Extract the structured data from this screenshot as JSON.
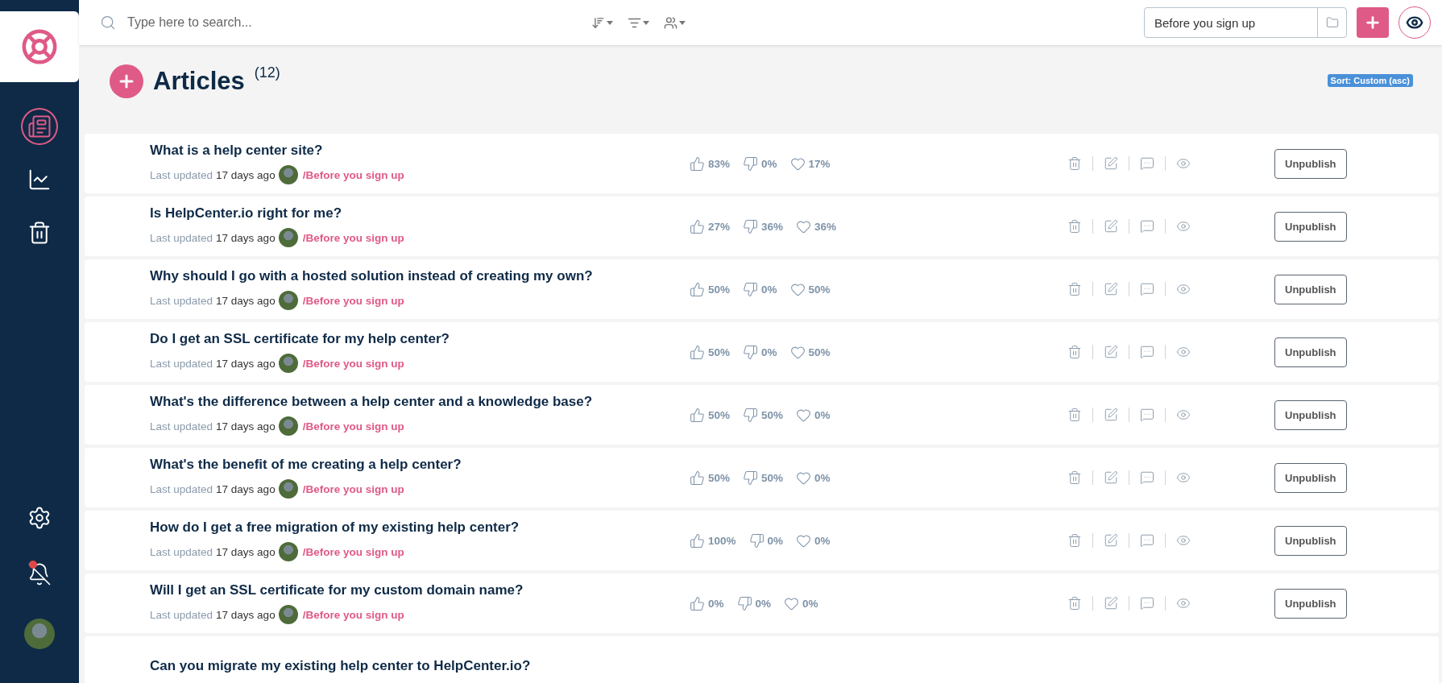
{
  "sidebar": {
    "items": [
      {
        "kind": "articles",
        "selected": true,
        "alert": false
      },
      {
        "kind": "analytics",
        "selected": false,
        "alert": false
      },
      {
        "kind": "trash",
        "selected": false,
        "alert": false
      },
      {
        "kind": "settings",
        "selected": false,
        "alert": false
      },
      {
        "kind": "notifications",
        "selected": false,
        "alert": true
      },
      {
        "kind": "profile",
        "selected": false,
        "alert": false
      }
    ]
  },
  "search": {
    "placeholder": "Type here to search..."
  },
  "toolbar": {
    "category_field": {
      "value": "Before you sign up"
    }
  },
  "header": {
    "title": "Articles",
    "count": "(12)",
    "sort_badge": "Sort: Custom (asc)"
  },
  "articles": [
    {
      "title": "What is a help center site?",
      "updated_label": "Last updated",
      "updated": "17 days ago",
      "category": "/Before you sign up",
      "likes": "83%",
      "dislikes": "0%",
      "loves": "17%",
      "action": "Unpublish"
    },
    {
      "title": "Is HelpCenter.io right for me?",
      "updated_label": "Last updated",
      "updated": "17 days ago",
      "category": "/Before you sign up",
      "likes": "27%",
      "dislikes": "36%",
      "loves": "36%",
      "action": "Unpublish"
    },
    {
      "title": "Why should I go with a hosted solution instead of creating my own?",
      "updated_label": "Last updated",
      "updated": "17 days ago",
      "category": "/Before you sign up",
      "likes": "50%",
      "dislikes": "0%",
      "loves": "50%",
      "action": "Unpublish"
    },
    {
      "title": "Do I get an SSL certificate for my help center?",
      "updated_label": "Last updated",
      "updated": "17 days ago",
      "category": "/Before you sign up",
      "likes": "50%",
      "dislikes": "0%",
      "loves": "50%",
      "action": "Unpublish"
    },
    {
      "title": "What's the difference between a help center and a knowledge base?",
      "updated_label": "Last updated",
      "updated": "17 days ago",
      "category": "/Before you sign up",
      "likes": "50%",
      "dislikes": "50%",
      "loves": "0%",
      "action": "Unpublish"
    },
    {
      "title": "What's the benefit of me creating a help center?",
      "updated_label": "Last updated",
      "updated": "17 days ago",
      "category": "/Before you sign up",
      "likes": "50%",
      "dislikes": "50%",
      "loves": "0%",
      "action": "Unpublish"
    },
    {
      "title": "How do I get a free migration of my existing help center?",
      "updated_label": "Last updated",
      "updated": "17 days ago",
      "category": "/Before you sign up",
      "likes": "100%",
      "dislikes": "0%",
      "loves": "0%",
      "action": "Unpublish"
    },
    {
      "title": "Will I get an SSL certificate for my custom domain name?",
      "updated_label": "Last updated",
      "updated": "17 days ago",
      "category": "/Before you sign up",
      "likes": "0%",
      "dislikes": "0%",
      "loves": "0%",
      "action": "Unpublish"
    },
    {
      "title": "Can you migrate my existing help center to HelpCenter.io?"
    }
  ]
}
